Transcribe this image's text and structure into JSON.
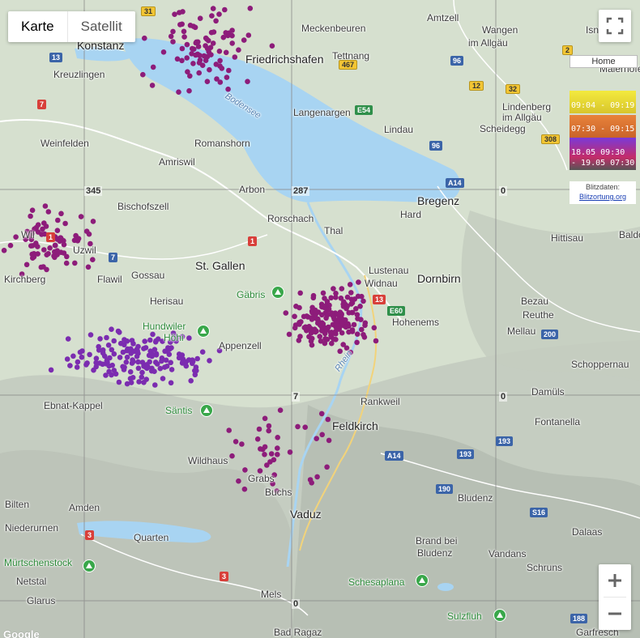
{
  "map_type_control": {
    "map_label": "Karte",
    "satellite_label": "Satellit",
    "selected": "Karte"
  },
  "colors": {
    "water": "#a8d4f2",
    "land": "#d5dfd0",
    "strike_recent": "#8d1c7a",
    "strike_old": "#7b2cb0",
    "legend_yellow": "#f3ea3e",
    "legend_orange": "#e9833a",
    "legend_purple": "#7a3ad8"
  },
  "place_labels": [
    {
      "name": "Konstanz"
    },
    {
      "name": "Friedrichshafen"
    },
    {
      "name": "Meckenbeuren"
    },
    {
      "name": "Amtzell"
    },
    {
      "name": "Wangen"
    },
    {
      "name": "im Allgäu"
    },
    {
      "name": "Isny"
    },
    {
      "name": "Maierhöfe"
    },
    {
      "name": "Tettnang"
    },
    {
      "name": "Kreuzlingen"
    },
    {
      "name": "Langenargen"
    },
    {
      "name": "Lindenberg"
    },
    {
      "name": "im Allgäu"
    },
    {
      "name": "Scheidegg"
    },
    {
      "name": "Lindau"
    },
    {
      "name": "Weinfelden"
    },
    {
      "name": "Romanshorn"
    },
    {
      "name": "Amriswil"
    },
    {
      "name": "Arbon"
    },
    {
      "name": "Bischofszell"
    },
    {
      "name": "Rorschach"
    },
    {
      "name": "Bregenz"
    },
    {
      "name": "Hard"
    },
    {
      "name": "Thal"
    },
    {
      "name": "Hittisau"
    },
    {
      "name": "Uzwil"
    },
    {
      "name": "Gossau"
    },
    {
      "name": "St. Gallen"
    },
    {
      "name": "Flawil"
    },
    {
      "name": "Kirchberg"
    },
    {
      "name": "Lustenau"
    },
    {
      "name": "Widnau"
    },
    {
      "name": "Dornbirn"
    },
    {
      "name": "Herisau"
    },
    {
      "name": "Bezau"
    },
    {
      "name": "Reuthe"
    },
    {
      "name": "Mellau"
    },
    {
      "name": "Hohenems"
    },
    {
      "name": "Appenzell"
    },
    {
      "name": "Schoppernau"
    },
    {
      "name": "Damüls"
    },
    {
      "name": "Ebnat-Kappel"
    },
    {
      "name": "Rankweil"
    },
    {
      "name": "Fontanella"
    },
    {
      "name": "Feldkirch"
    },
    {
      "name": "Wildhaus"
    },
    {
      "name": "Grabs"
    },
    {
      "name": "Buchs"
    },
    {
      "name": "Vaduz"
    },
    {
      "name": "Bludenz"
    },
    {
      "name": "Bilten"
    },
    {
      "name": "Amden"
    },
    {
      "name": "Niederurnen"
    },
    {
      "name": "Quarten"
    },
    {
      "name": "Dalaas"
    },
    {
      "name": "Brand bei"
    },
    {
      "name": "Bludenz"
    },
    {
      "name": "Vandans"
    },
    {
      "name": "Schruns"
    },
    {
      "name": "Netstal"
    },
    {
      "name": "Glarus"
    },
    {
      "name": "Mels"
    },
    {
      "name": "Bad Ragaz"
    },
    {
      "name": "Garfresch"
    },
    {
      "name": "Wil"
    },
    {
      "name": "Baldo"
    }
  ],
  "peak_labels": [
    {
      "name": "Gäbris"
    },
    {
      "name": "Hundwiler"
    },
    {
      "name": "Höhi"
    },
    {
      "name": "Säntis"
    },
    {
      "name": "Mürtschenstock"
    },
    {
      "name": "Schesaplana"
    },
    {
      "name": "Sulzfluh"
    }
  ],
  "water_labels": [
    {
      "name": "Bodensee"
    },
    {
      "name": "Rhein"
    }
  ],
  "road_shields": [
    {
      "text": "31",
      "style": "yel"
    },
    {
      "text": "467",
      "style": "yel"
    },
    {
      "text": "96",
      "style": "blue"
    },
    {
      "text": "2",
      "style": "yel"
    },
    {
      "text": "13",
      "style": "blue"
    },
    {
      "text": "12",
      "style": "yel"
    },
    {
      "text": "32",
      "style": "yel"
    },
    {
      "text": "7",
      "style": "red"
    },
    {
      "text": "E54",
      "style": "grn"
    },
    {
      "text": "308",
      "style": "yel"
    },
    {
      "text": "96",
      "style": "blue"
    },
    {
      "text": "A14",
      "style": "blue"
    },
    {
      "text": "1",
      "style": "red"
    },
    {
      "text": "1",
      "style": "red"
    },
    {
      "text": "7",
      "style": "blue"
    },
    {
      "text": "13",
      "style": "red"
    },
    {
      "text": "E60",
      "style": "grn"
    },
    {
      "text": "200",
      "style": "blue"
    },
    {
      "text": "193",
      "style": "blue"
    },
    {
      "text": "A14",
      "style": "blue"
    },
    {
      "text": "193",
      "style": "blue"
    },
    {
      "text": "190",
      "style": "blue"
    },
    {
      "text": "S16",
      "style": "blue"
    },
    {
      "text": "3",
      "style": "red"
    },
    {
      "text": "3",
      "style": "red"
    },
    {
      "text": "188",
      "style": "blue"
    }
  ],
  "grid_labels": [
    {
      "text": "345"
    },
    {
      "text": "287"
    },
    {
      "text": "0"
    },
    {
      "text": "7"
    },
    {
      "text": "0"
    },
    {
      "text": "0"
    }
  ],
  "legend": {
    "home_label": "Home",
    "items": [
      {
        "text": "09:04 - 09:19"
      },
      {
        "text": "07:30 - 09:15"
      },
      {
        "text": "18.05 09:30"
      },
      {
        "text": "- 19.05 07:30"
      }
    ],
    "credit_title": "Blitzdaten:",
    "credit_link": "Blitzortung.org"
  },
  "zoom": {
    "in_symbol": "+",
    "out_symbol": "−"
  },
  "google_logo": "Google",
  "lightning_clusters": [
    {
      "count": 90,
      "density": "high"
    },
    {
      "count": 80,
      "density": "high"
    },
    {
      "count": 170,
      "density": "very-high"
    },
    {
      "count": 160,
      "density": "very-high"
    },
    {
      "count": 40,
      "density": "low"
    }
  ]
}
